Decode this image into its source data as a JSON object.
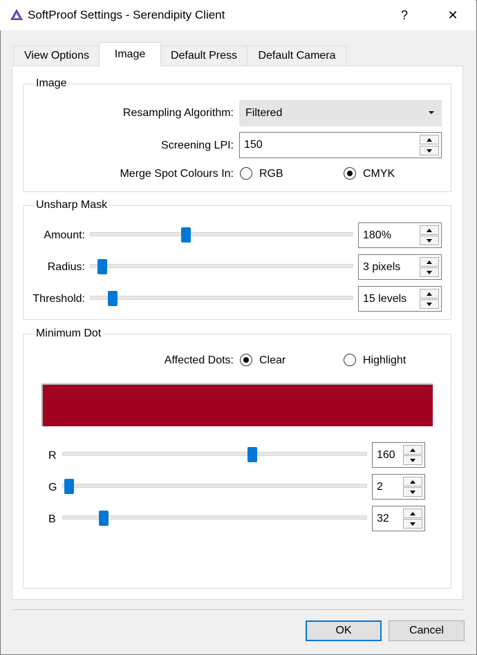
{
  "window": {
    "title": "SoftProof Settings - Serendipity Client",
    "help_glyph": "?",
    "close_glyph": "✕"
  },
  "tabs": [
    {
      "label": "View Options",
      "active": false
    },
    {
      "label": "Image",
      "active": true
    },
    {
      "label": "Default Press",
      "active": false
    },
    {
      "label": "Default Camera",
      "active": false
    }
  ],
  "image_group": {
    "title": "Image",
    "resampling_label": "Resampling Algorithm:",
    "resampling_value": "Filtered",
    "screening_label": "Screening LPI:",
    "screening_value": "150",
    "merge_label": "Merge Spot Colours In:",
    "merge_options": [
      {
        "label": "RGB",
        "selected": false
      },
      {
        "label": "CMYK",
        "selected": true
      }
    ]
  },
  "unsharp_group": {
    "title": "Unsharp Mask",
    "amount": {
      "label": "Amount:",
      "value": "180%",
      "slider_fraction": 0.36
    },
    "radius": {
      "label": "Radius:",
      "value": "3 pixels",
      "slider_fraction": 0.03
    },
    "threshold": {
      "label": "Threshold:",
      "value": "15 levels",
      "slider_fraction": 0.07
    }
  },
  "min_dot_group": {
    "title": "Minimum Dot",
    "affected_label": "Affected Dots:",
    "affected_options": [
      {
        "label": "Clear",
        "selected": true
      },
      {
        "label": "Highlight",
        "selected": false
      }
    ],
    "swatch_color": "#a00220",
    "r": {
      "label": "R",
      "value": "160",
      "slider_fraction": 0.627
    },
    "g": {
      "label": "G",
      "value": "2",
      "slider_fraction": 0.008
    },
    "b": {
      "label": "B",
      "value": "32",
      "slider_fraction": 0.125
    }
  },
  "buttons": {
    "ok": "OK",
    "cancel": "Cancel"
  },
  "colors": {
    "accent": "#0078d7"
  }
}
